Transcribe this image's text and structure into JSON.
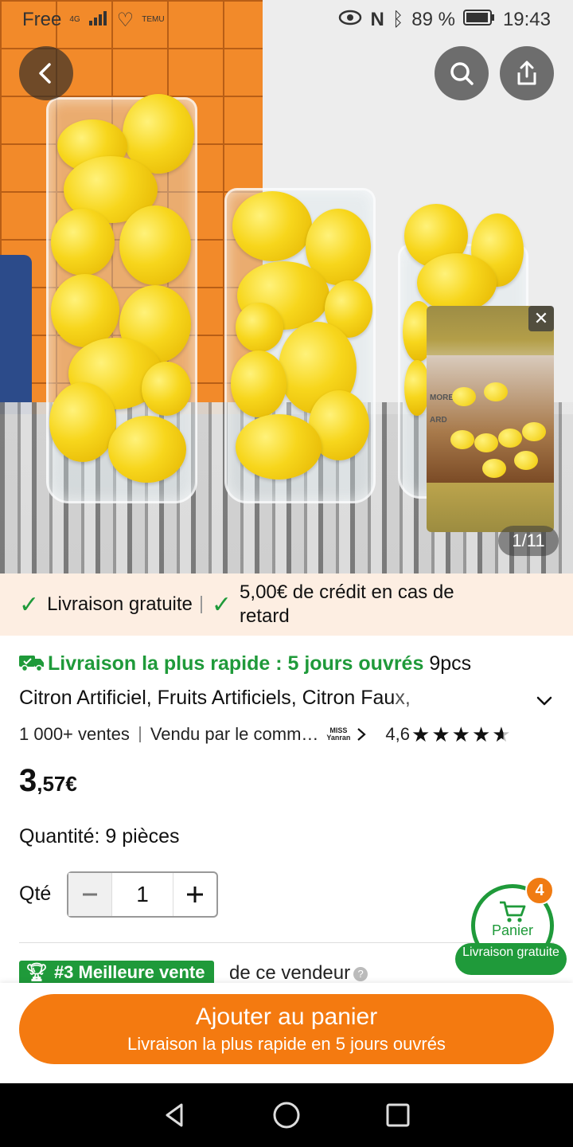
{
  "status_bar": {
    "carrier": "Free",
    "network": "4G",
    "extra_label": "TEMU",
    "battery": "89 %",
    "time": "19:43"
  },
  "gallery": {
    "counter": "1/11",
    "close_symbol": "✕",
    "mini_labels": [
      "MORE",
      "ARD"
    ]
  },
  "delivery_banner": {
    "free_shipping": "Livraison gratuite",
    "credit": "5,00€ de crédit en cas de retard"
  },
  "product": {
    "fast_delivery": "Livraison la plus rapide : 5 jours ouvrés",
    "title_part1": " 9pcs",
    "title_part2": "Citron Artificiel, Fruits Artificiels, Citron Fau",
    "title_faded": "x,",
    "sales": "1 000+ ventes",
    "sold_by": "Vendu par le comm…",
    "shop_logo_line1": "MISS",
    "shop_logo_line2": "Yanran",
    "rating": "4,6",
    "rating_value": 4.6,
    "price_int": "3",
    "price_dec": ",57€",
    "quantity_label": "Quantité: 9 pièces",
    "qty_label": "Qté",
    "qty_value": "1",
    "best_seller_badge": "#3 Meilleure vente",
    "best_seller_text": "de ce vendeur"
  },
  "cart": {
    "label": "Panier",
    "count": "4",
    "pill": "Livraison gratuite"
  },
  "cta": {
    "main": "Ajouter au panier",
    "sub": "Livraison la plus rapide en 5 jours ouvrés"
  },
  "colors": {
    "accent_orange": "#f47a10",
    "accent_green": "#1f9a3a"
  }
}
